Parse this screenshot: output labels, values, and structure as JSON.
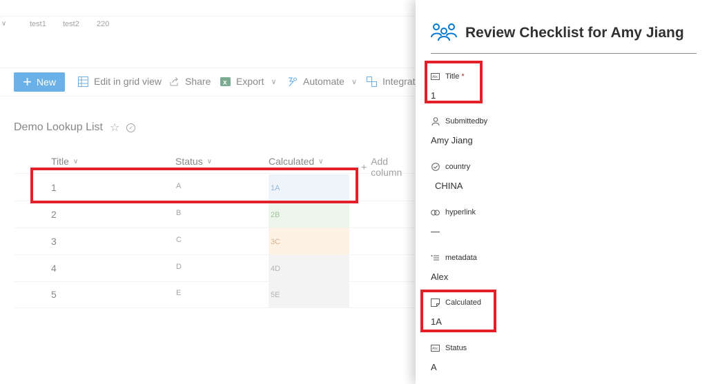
{
  "topnav": {
    "links": [
      "test1",
      "test2",
      "220"
    ]
  },
  "commandbar": {
    "new_label": "New",
    "edit_grid_label": "Edit in grid view",
    "share_label": "Share",
    "export_label": "Export",
    "automate_label": "Automate",
    "integrate_label": "Integrate"
  },
  "list": {
    "title": "Demo Lookup List",
    "columns": {
      "title": "Title",
      "status": "Status",
      "calculated": "Calculated",
      "add_column": "Add column"
    },
    "rows": [
      {
        "title": "1",
        "status": "A",
        "calculated": "1A",
        "calc_bg": "#e3edf8",
        "calc_color": "#4a7fc0"
      },
      {
        "title": "2",
        "status": "B",
        "calculated": "2B",
        "calc_bg": "#dff0dc",
        "calc_color": "#5e9a55"
      },
      {
        "title": "3",
        "status": "C",
        "calculated": "3C",
        "calc_bg": "#fde8d3",
        "calc_color": "#b07a45"
      },
      {
        "title": "4",
        "status": "D",
        "calculated": "4D",
        "calc_bg": "#ebebeb",
        "calc_color": "#7a7a7a"
      },
      {
        "title": "5",
        "status": "E",
        "calculated": "5E",
        "calc_bg": "#ebebeb",
        "calc_color": "#7a7a7a"
      }
    ]
  },
  "panel": {
    "title": "Review Checklist for Amy Jiang",
    "fields": {
      "title": {
        "label": "Title",
        "required_mark": "*",
        "value": "1"
      },
      "submittedby": {
        "label": "Submittedby",
        "value": "Amy Jiang"
      },
      "country": {
        "label": "country",
        "value": "CHINA"
      },
      "hyperlink": {
        "label": "hyperlink",
        "value": "—"
      },
      "metadata": {
        "label": "metadata",
        "value": "Alex"
      },
      "calculated": {
        "label": "Calculated",
        "value": "1A"
      },
      "status": {
        "label": "Status",
        "value": "A"
      }
    }
  },
  "colors": {
    "accent": "#0078d4",
    "highlight": "#e3202a",
    "excel": "#1d6f42"
  }
}
